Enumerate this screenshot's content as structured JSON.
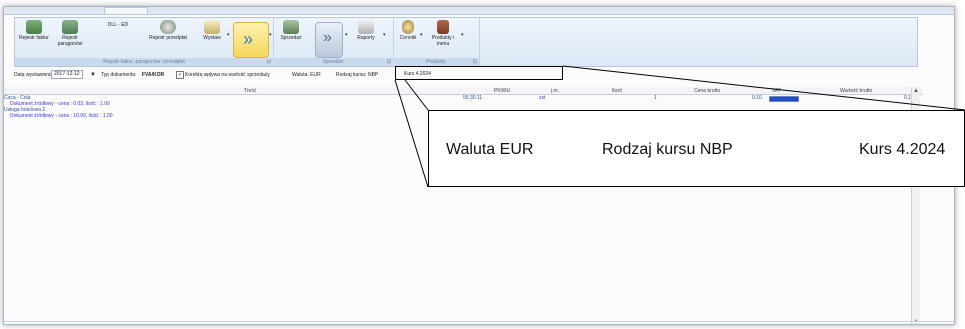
{
  "ribbon": {
    "group1": {
      "footer": "Rejestr faktur, paragonów i przedpłat",
      "buttons": [
        {
          "label": "Rejestr faktur",
          "icon": "invoice-register-icon"
        },
        {
          "label": "Rejestr paragonów",
          "icon": "receipt-register-icon"
        },
        {
          "label": "DLL - ED",
          "icon": "none"
        },
        {
          "label": "Rejestr przedpłat",
          "icon": "prepayment-register-icon"
        },
        {
          "label": "Wystaw",
          "icon": "issue-document-icon"
        }
      ]
    },
    "group2": {
      "footer": "Sprzedaż",
      "buttons": [
        {
          "label": "Sprzedaż",
          "icon": "sales-icon"
        },
        {
          "label": "Raporty",
          "icon": "reports-icon"
        }
      ]
    },
    "group3": {
      "footer": "Produkty",
      "buttons": [
        {
          "label": "Cenniki",
          "icon": "price-list-icon"
        },
        {
          "label": "Produkty i menu",
          "icon": "products-menu-icon"
        }
      ]
    }
  },
  "filters": {
    "date_label": "Data wystawienia:",
    "date_value": "2017-12-12",
    "doc_type_label": "Typ dokumentu:",
    "doc_type_value": "FVA/KOR",
    "checkbox_label": "Korekta wpływa na wartość sprzedaży",
    "waluta": "Waluta: EUR",
    "rodzaj": "Rodzaj kursu: NBP",
    "kurs": "Kurs 4.2024"
  },
  "grid": {
    "columns": [
      "Treść",
      "PKWiU",
      "j.m.",
      "Ilość",
      "Cena brutto",
      "VAT",
      "Wartość brutto"
    ],
    "rows": [
      {
        "type": "item",
        "tresc": "Coca - Cola",
        "pkwiu": "55.30.11",
        "jm": "szt",
        "ilosc": "1",
        "cena": "0.10",
        "vat": "",
        "wartosc": "0.1"
      },
      {
        "type": "sub",
        "tresc": "Dokument źródłowy - cena : 0.03, ilość : 1.00"
      },
      {
        "type": "item",
        "tresc": "Usługa hotelowa 2",
        "pkwiu": "",
        "jm": "",
        "ilosc": "",
        "cena": "",
        "vat": "",
        "wartosc": ""
      },
      {
        "type": "sub",
        "tresc": "Dokument źródłowy - cena : 10.00, ilość : 1.00"
      }
    ]
  },
  "zoom": {
    "waluta": "Waluta  EUR",
    "rodzaj": "Rodzaj kursu  NBP",
    "kurs": "Kurs 4.2024"
  }
}
